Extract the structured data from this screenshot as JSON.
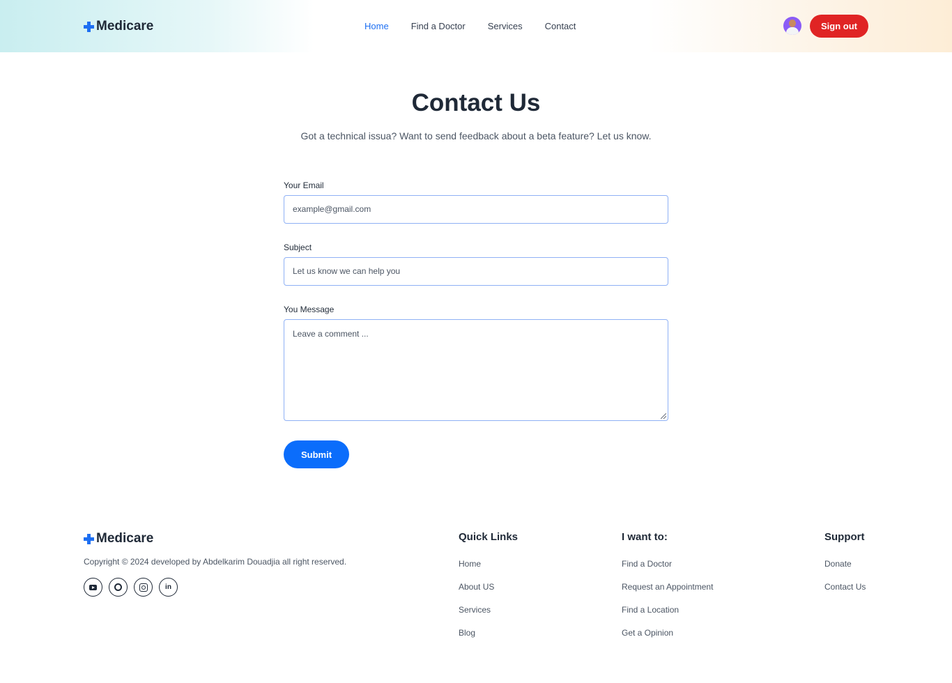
{
  "brand": {
    "name": "Medicare",
    "accent": "#1d6ff2"
  },
  "nav": {
    "items": [
      "Home",
      "Find a Doctor",
      "Services",
      "Contact"
    ],
    "active": "Home"
  },
  "header": {
    "signout_label": "Sign out",
    "signout_color": "#e02424"
  },
  "page": {
    "title": "Contact Us",
    "subtitle": "Got a technical issua? Want to send feedback about a beta feature? Let us know."
  },
  "form": {
    "email_label": "Your Email",
    "email_placeholder": "example@gmail.com",
    "subject_label": "Subject",
    "subject_placeholder": "Let us know we can help you",
    "message_label": "You Message",
    "message_placeholder": "Leave a comment ...",
    "submit_label": "Submit",
    "submit_color": "#0b6dfb"
  },
  "footer": {
    "copyright": "Copyright © 2024 developed by Abdelkarim Douadjia all right reserved.",
    "socials": [
      "youtube-icon",
      "github-icon",
      "instagram-icon",
      "linkedin-icon"
    ],
    "quick_links": {
      "title": "Quick Links",
      "items": [
        "Home",
        "About US",
        "Services",
        "Blog"
      ]
    },
    "i_want_to": {
      "title": "I want to:",
      "items": [
        "Find a Doctor",
        "Request an Appointment",
        "Find a Location",
        "Get a Opinion"
      ]
    },
    "support": {
      "title": "Support",
      "items": [
        "Donate",
        "Contact Us"
      ]
    }
  }
}
